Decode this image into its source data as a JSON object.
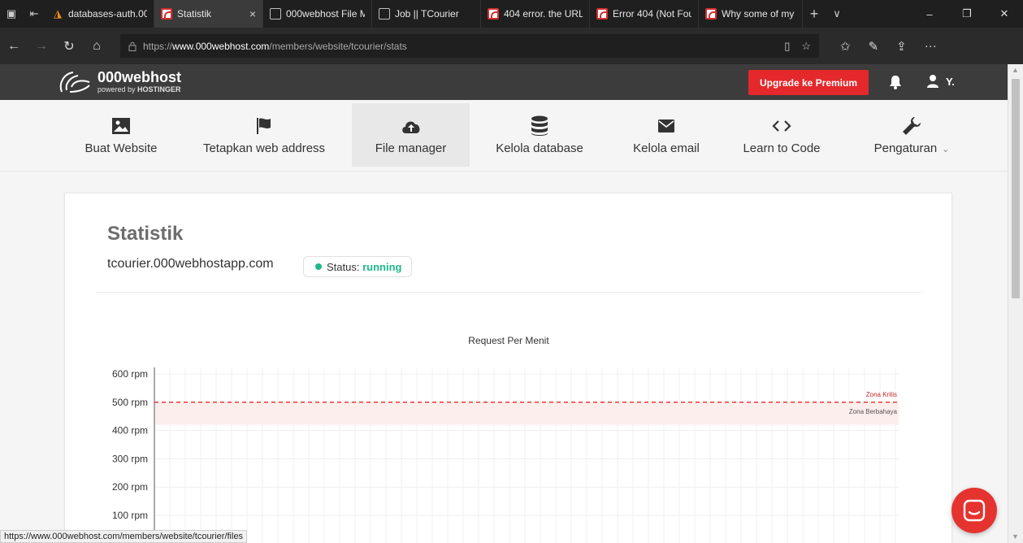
{
  "browser": {
    "tabs": [
      {
        "title": "databases-auth.00(",
        "favicon": "mysql-icon",
        "active": false
      },
      {
        "title": "Statistik",
        "favicon": "000webhost-icon",
        "active": true,
        "close": "×"
      },
      {
        "title": "000webhost File M",
        "favicon": "page-icon",
        "active": false
      },
      {
        "title": "Job || TCourier",
        "favicon": "page-icon",
        "active": false
      },
      {
        "title": "404 error. the URL",
        "favicon": "000webhost-icon",
        "active": false
      },
      {
        "title": "Error 404 (Not Fou",
        "favicon": "000webhost-icon",
        "active": false
      },
      {
        "title": "Why some of my w",
        "favicon": "000webhost-icon",
        "active": false
      }
    ],
    "new_tab": "+",
    "tab_list": "∨",
    "window": {
      "minimize": "–",
      "restore": "❐",
      "close": "✕"
    },
    "address": {
      "prefix": "https://",
      "host": "www.000webhost.com",
      "path": "/members/website/tcourier/stats"
    },
    "nav": {
      "back": "←",
      "forward": "→",
      "refresh": "↻",
      "home": "⌂"
    },
    "toolbar_icons": [
      "reading-view-icon",
      "favorite-star-icon",
      "favorites-hub-icon",
      "pen-icon",
      "share-icon",
      "more-icon"
    ],
    "more": "···",
    "hover_url": "https://www.000webhost.com/members/website/tcourier/files"
  },
  "site": {
    "logo_name": "000webhost",
    "logo_sub_prefix": "powered by ",
    "logo_sub_brand": "HOSTINGER",
    "upgrade_label": "Upgrade ke Premium",
    "user_label": "Y.",
    "colors": {
      "accent_red": "#e4282b",
      "status_green": "#1fb88c",
      "header_bg": "#3c3c3c"
    }
  },
  "nav_items": [
    {
      "label": "Buat Website",
      "icon": "image-icon"
    },
    {
      "label": "Tetapkan web address",
      "icon": "flag-icon"
    },
    {
      "label": "File manager",
      "icon": "cloud-upload-icon",
      "active": true
    },
    {
      "label": "Kelola database",
      "icon": "database-icon"
    },
    {
      "label": "Kelola email",
      "icon": "envelope-icon"
    },
    {
      "label": "Learn to Code",
      "icon": "code-icon"
    },
    {
      "label": "Pengaturan",
      "icon": "wrench-icon",
      "dropdown": "⌄"
    }
  ],
  "stats": {
    "title": "Statistik",
    "domain": "tcourier.000webhostapp.com",
    "status_label": "Status: ",
    "status_value": "running"
  },
  "chart_data": {
    "type": "line",
    "title": "Request Per Menit",
    "xlabel": "",
    "ylabel": "",
    "ylim": [
      0,
      600
    ],
    "y_ticks": [
      "600 rpm",
      "500 rpm",
      "400 rpm",
      "300 rpm",
      "200 rpm",
      "100 rpm"
    ],
    "y_tick_values": [
      600,
      500,
      400,
      300,
      200,
      100
    ],
    "grid": true,
    "annotations": [
      {
        "label": "Zona Kritis",
        "value": 500,
        "style": "dashed-line",
        "color": "#e4282b"
      },
      {
        "label": "Zona Berbahaya",
        "from": 420,
        "to": 500,
        "style": "band",
        "color": "#fdeeee"
      }
    ],
    "series": []
  }
}
